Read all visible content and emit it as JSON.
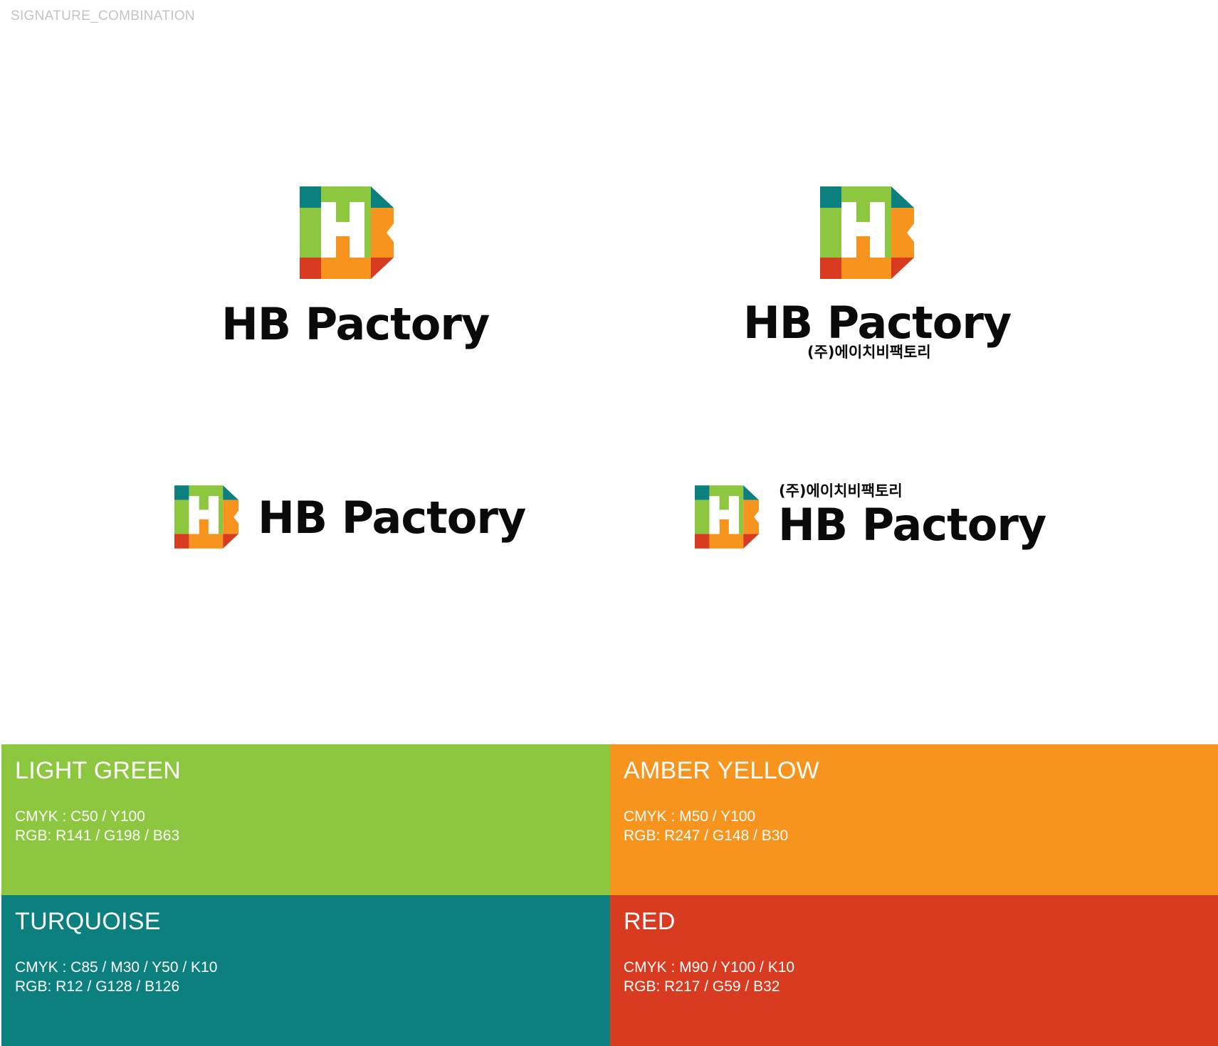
{
  "section_label": "SIGNATURE_COMBINATION",
  "logo": {
    "wordmark": "HB Pactory",
    "korean_name": "(주)에이치비팩토리",
    "colors": {
      "light_green": "#8DC63F",
      "amber_yellow": "#F7941E",
      "turquoise": "#0C807E",
      "red": "#D93B20",
      "text": "#0a0a0a"
    }
  },
  "swatches": [
    {
      "name": "LIGHT GREEN",
      "cmyk": "CMYK : C50 / Y100",
      "rgb": "RGB: R141 / G198 / B63",
      "color": "#8DC63F"
    },
    {
      "name": "AMBER YELLOW",
      "cmyk": "CMYK : M50 / Y100",
      "rgb": "RGB: R247 / G148 / B30",
      "color": "#F7941E"
    },
    {
      "name": "TURQUOISE",
      "cmyk": "CMYK : C85 / M30 / Y50 / K10",
      "rgb": "RGB: R12 / G128 / B126",
      "color": "#0C807E"
    },
    {
      "name": "RED",
      "cmyk": "CMYK : M90 / Y100 / K10",
      "rgb": "RGB: R217 / G59 / B32",
      "color": "#D93B20"
    }
  ]
}
